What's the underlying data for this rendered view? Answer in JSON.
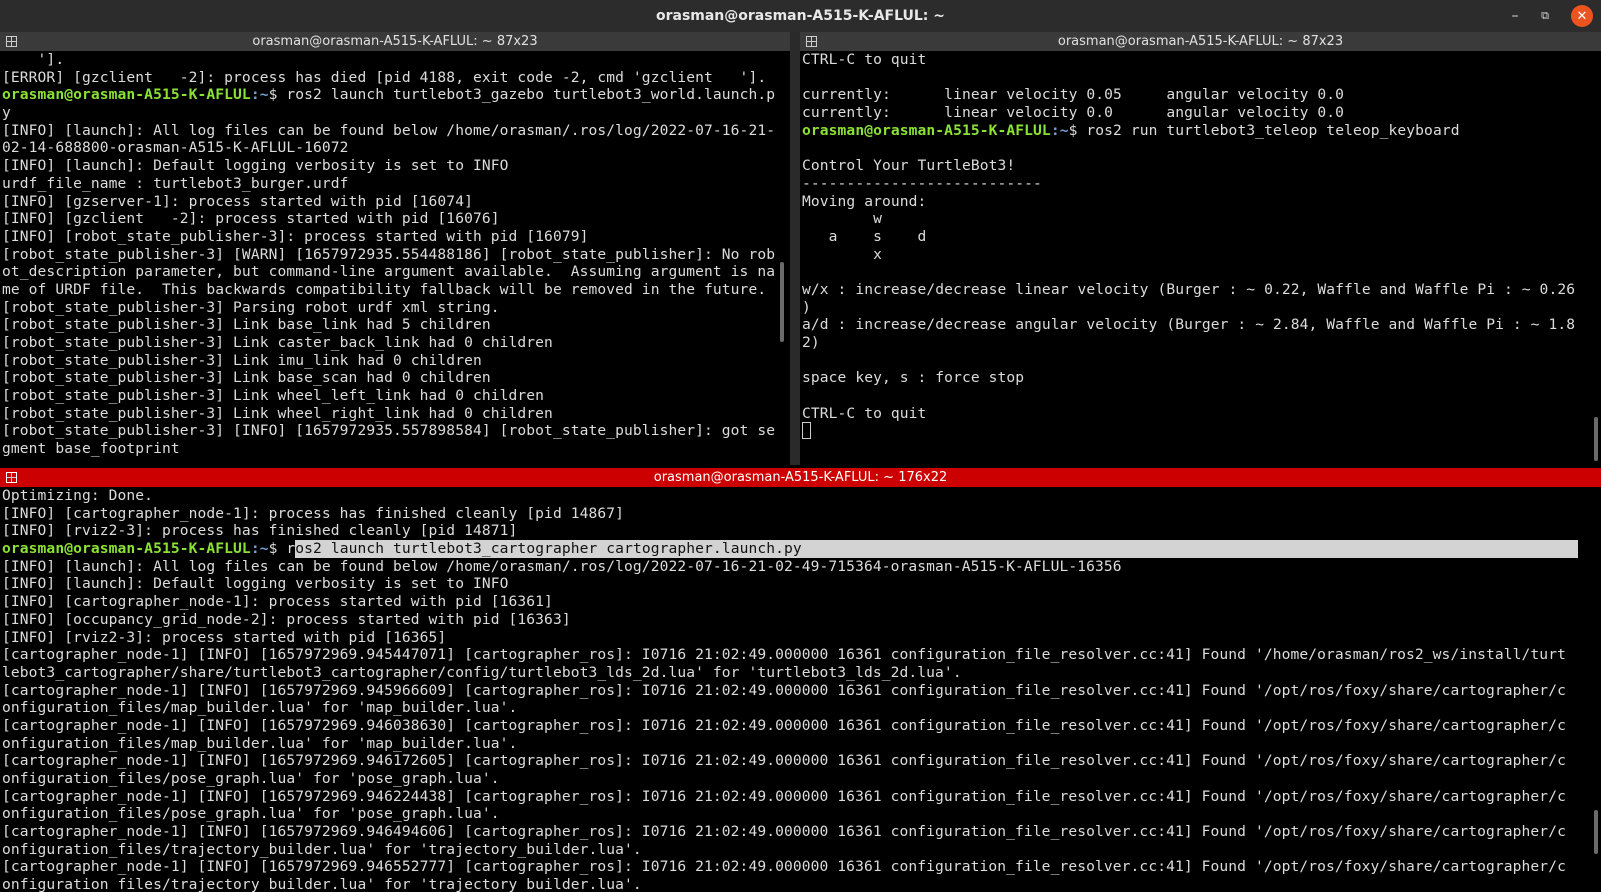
{
  "window": {
    "title": "orasman@orasman-A515-K-AFLUL: ~",
    "controls": {
      "minimize": "–",
      "maximize": "⧉",
      "close": "✕"
    }
  },
  "panes": {
    "top_left": {
      "title": "orasman@orasman-A515-K-AFLUL: ~ 87x23",
      "lines": [
        "    '].",
        "[ERROR] [gzclient   -2]: process has died [pid 4188, exit code -2, cmd 'gzclient   '].",
        "",
        "[INFO] [launch]: All log files can be found below /home/orasman/.ros/log/2022-07-16-21-",
        "02-14-688800-orasman-A515-K-AFLUL-16072",
        "[INFO] [launch]: Default logging verbosity is set to INFO",
        "urdf_file_name : turtlebot3_burger.urdf",
        "[INFO] [gzserver-1]: process started with pid [16074]",
        "[INFO] [gzclient   -2]: process started with pid [16076]",
        "[INFO] [robot_state_publisher-3]: process started with pid [16079]",
        "[robot_state_publisher-3] [WARN] [1657972935.554488186] [robot_state_publisher]: No rob",
        "ot_description parameter, but command-line argument available.  Assuming argument is na",
        "me of URDF file.  This backwards compatibility fallback will be removed in the future.",
        "[robot_state_publisher-3] Parsing robot urdf xml string.",
        "[robot_state_publisher-3] Link base_link had 5 children",
        "[robot_state_publisher-3] Link caster_back_link had 0 children",
        "[robot_state_publisher-3] Link imu_link had 0 children",
        "[robot_state_publisher-3] Link base_scan had 0 children",
        "[robot_state_publisher-3] Link wheel_left_link had 0 children",
        "[robot_state_publisher-3] Link wheel_right_link had 0 children",
        "[robot_state_publisher-3] [INFO] [1657972935.557898584] [robot_state_publisher]: got se",
        "gment base_footprint"
      ],
      "prompt_user": "orasman@orasman-A515-K-AFLUL",
      "prompt_path": ":~",
      "prompt_cmd": "$ ros2 launch turtlebot3_gazebo turtlebot3_world.launch.p",
      "prompt_cont": "y"
    },
    "top_right": {
      "title": "orasman@orasman-A515-K-AFLUL: ~ 87x23",
      "lines_before": [
        "CTRL-C to quit",
        "",
        "currently:      linear velocity 0.05     angular velocity 0.0",
        "currently:      linear velocity 0.0      angular velocity 0.0"
      ],
      "prompt_user": "orasman@orasman-A515-K-AFLUL",
      "prompt_path": ":~",
      "prompt_cmd": "$ ros2 run turtlebot3_teleop teleop_keyboard",
      "lines_after": [
        "",
        "Control Your TurtleBot3!",
        "---------------------------",
        "Moving around:",
        "        w",
        "   a    s    d",
        "        x",
        "",
        "w/x : increase/decrease linear velocity (Burger : ~ 0.22, Waffle and Waffle Pi : ~ 0.26",
        ")",
        "a/d : increase/decrease angular velocity (Burger : ~ 2.84, Waffle and Waffle Pi : ~ 1.8",
        "2)",
        "",
        "space key, s : force stop",
        "",
        "CTRL-C to quit",
        ""
      ]
    },
    "bottom": {
      "title": "orasman@orasman-A515-K-AFLUL: ~ 176x22",
      "lines_before": [
        "Optimizing: Done.",
        "[INFO] [cartographer_node-1]: process has finished cleanly [pid 14867]",
        "[INFO] [rviz2-3]: process has finished cleanly [pid 14871]"
      ],
      "prompt_user": "orasman@orasman-A515-K-AFLUL",
      "prompt_path": ":~",
      "prompt_dollar": "$ r",
      "prompt_selected": "os2 launch turtlebot3_cartographer cartographer.launch.py",
      "lines_after": [
        "[INFO] [launch]: All log files can be found below /home/orasman/.ros/log/2022-07-16-21-02-49-715364-orasman-A515-K-AFLUL-16356",
        "[INFO] [launch]: Default logging verbosity is set to INFO",
        "[INFO] [cartographer_node-1]: process started with pid [16361]",
        "[INFO] [occupancy_grid_node-2]: process started with pid [16363]",
        "[INFO] [rviz2-3]: process started with pid [16365]",
        "[cartographer_node-1] [INFO] [1657972969.945447071] [cartographer_ros]: I0716 21:02:49.000000 16361 configuration_file_resolver.cc:41] Found '/home/orasman/ros2_ws/install/turt",
        "lebot3_cartographer/share/turtlebot3_cartographer/config/turtlebot3_lds_2d.lua' for 'turtlebot3_lds_2d.lua'.",
        "[cartographer_node-1] [INFO] [1657972969.945966609] [cartographer_ros]: I0716 21:02:49.000000 16361 configuration_file_resolver.cc:41] Found '/opt/ros/foxy/share/cartographer/c",
        "onfiguration_files/map_builder.lua' for 'map_builder.lua'.",
        "[cartographer_node-1] [INFO] [1657972969.946038630] [cartographer_ros]: I0716 21:02:49.000000 16361 configuration_file_resolver.cc:41] Found '/opt/ros/foxy/share/cartographer/c",
        "onfiguration_files/map_builder.lua' for 'map_builder.lua'.",
        "[cartographer_node-1] [INFO] [1657972969.946172605] [cartographer_ros]: I0716 21:02:49.000000 16361 configuration_file_resolver.cc:41] Found '/opt/ros/foxy/share/cartographer/c",
        "onfiguration_files/pose_graph.lua' for 'pose_graph.lua'.",
        "[cartographer_node-1] [INFO] [1657972969.946224438] [cartographer_ros]: I0716 21:02:49.000000 16361 configuration_file_resolver.cc:41] Found '/opt/ros/foxy/share/cartographer/c",
        "onfiguration_files/pose_graph.lua' for 'pose_graph.lua'.",
        "[cartographer_node-1] [INFO] [1657972969.946494606] [cartographer_ros]: I0716 21:02:49.000000 16361 configuration_file_resolver.cc:41] Found '/opt/ros/foxy/share/cartographer/c",
        "onfiguration_files/trajectory_builder.lua' for 'trajectory_builder.lua'.",
        "[cartographer_node-1] [INFO] [1657972969.946552777] [cartographer_ros]: I0716 21:02:49.000000 16361 configuration_file_resolver.cc:41] Found '/opt/ros/foxy/share/cartographer/c",
        "onfiguration_files/trajectory_builder.lua' for 'trajectory_builder.lua'."
      ]
    }
  },
  "colors": {
    "active_pane_title": "#cc0000",
    "prompt_user": "#8ae234",
    "prompt_path": "#729fcf",
    "close_button": "#e95420"
  },
  "icons": [
    "split-pane-icon",
    "minimize-icon",
    "maximize-icon",
    "close-icon"
  ]
}
